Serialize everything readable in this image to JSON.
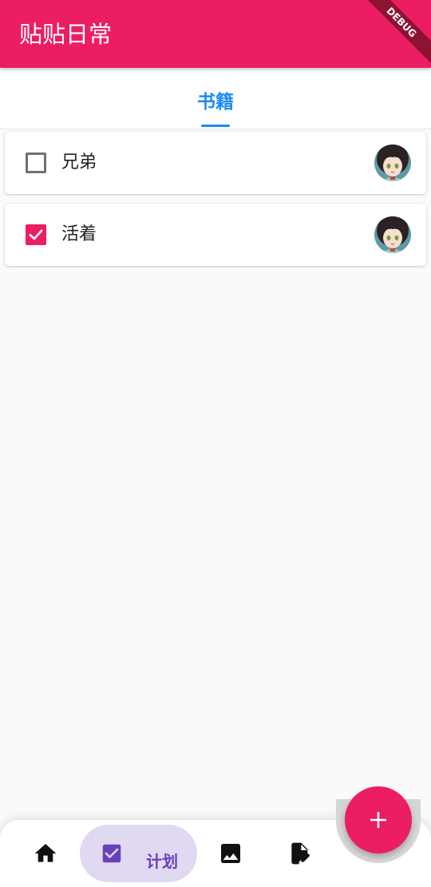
{
  "app": {
    "title": "贴贴日常",
    "debug_label": "DEBUG"
  },
  "tabs": [
    {
      "label": "书籍",
      "selected": true
    }
  ],
  "books": [
    {
      "title": "兄弟",
      "checked": false
    },
    {
      "title": "活着",
      "checked": true
    }
  ],
  "bottom_nav": {
    "items": [
      {
        "icon": "home-icon",
        "label": ""
      },
      {
        "icon": "checkbox-icon",
        "label": "计划",
        "selected": true
      },
      {
        "icon": "image-icon",
        "label": ""
      },
      {
        "icon": "edit-document-icon",
        "label": ""
      }
    ]
  },
  "fab": {
    "icon": "plus-icon"
  },
  "colors": {
    "primary": "#ec1e63",
    "tab_accent": "#1a8cf0",
    "nav_selected_bg": "#e1d8f2",
    "nav_selected_fg": "#6941b8"
  }
}
